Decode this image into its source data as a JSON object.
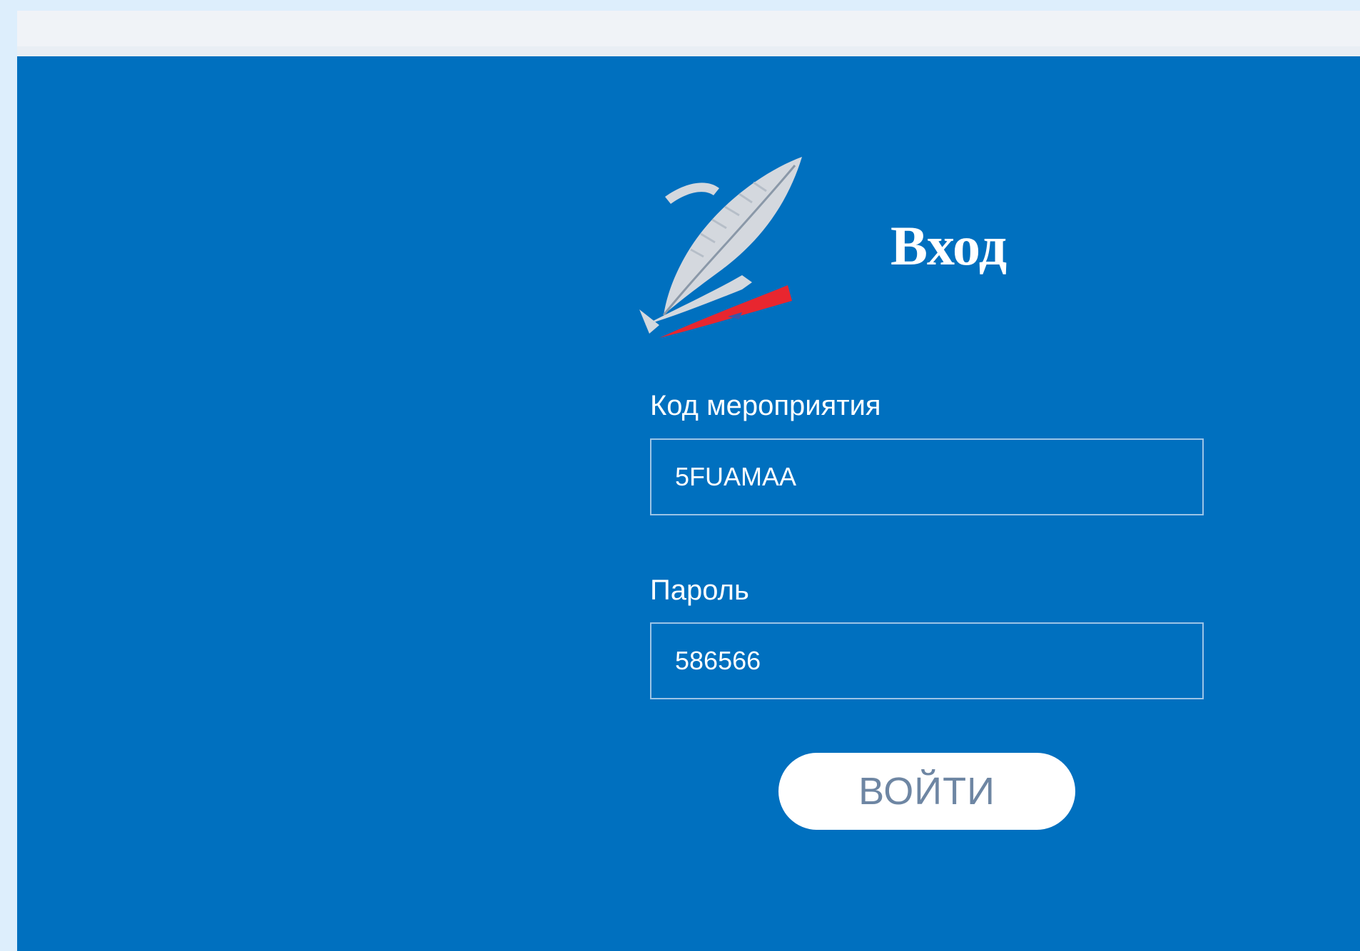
{
  "login": {
    "title": "Вход",
    "event_code_label": "Код мероприятия",
    "event_code_value": "5FUAMAA",
    "password_label": "Пароль",
    "password_value": "586566",
    "submit_label": "ВОЙТИ"
  },
  "colors": {
    "page_background": "#ddeefc",
    "panel_background": "#0070bf",
    "topbar": "#f0f3f7",
    "logo_feather": "#d4d8de",
    "logo_accent": "#e8262f",
    "button_text": "#6e86a3"
  },
  "icons": {
    "logo": "feather-quill-logo-icon"
  }
}
